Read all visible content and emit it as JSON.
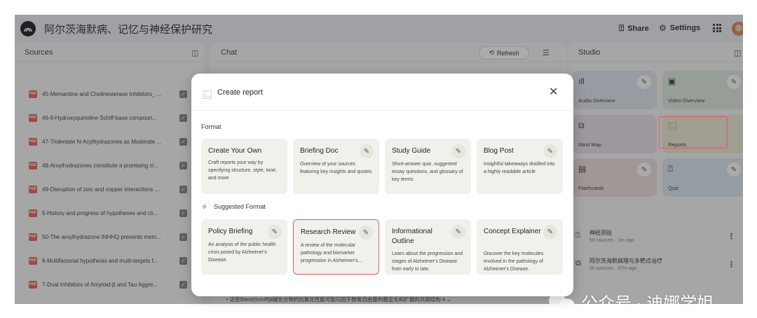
{
  "app": {
    "title": "阿尔茨海默病、记忆与神经保护研究",
    "share_label": "Share",
    "settings_label": "Settings",
    "icons": {
      "logo": "notebook-logo-icon",
      "share": "share-icon",
      "settings": "gear-icon",
      "apps": "apps-grid-icon",
      "avatar": "user-avatar"
    }
  },
  "sources": {
    "title": "Sources",
    "items": [
      {
        "label": "45-Memantine and Cholinesterase Inhibitors_ ...",
        "checked": true
      },
      {
        "label": "46-8-Hydroxyquinoline Schiff-base compoun...",
        "checked": true
      },
      {
        "label": "47-Tridentate N-Acylhydrazones as Moderate ...",
        "checked": true
      },
      {
        "label": "48-Aroylhydrazones constitute a promising cl...",
        "checked": true
      },
      {
        "label": "49-Disruption of zinc and copper interactions ...",
        "checked": true
      },
      {
        "label": "5-History and progress of hypotheses and cli...",
        "checked": true
      },
      {
        "label": "50-The aroylhydrazone INHHQ prevents mem...",
        "checked": true
      },
      {
        "label": "6-Multifactorial hypothesis and multi-targets f...",
        "checked": true
      },
      {
        "label": "7-Dual Inhibitors of Amyloid-β and Tau Aggre...",
        "checked": true
      }
    ]
  },
  "chat": {
    "title": "Chat",
    "refresh_label": "Refresh",
    "bottom_line": "• 这些$\\text{Schiff}$碱化合物的抗氧化性能可能归因于酚氧自由基的稳定化和扩展的共轭结构  4 ⌄"
  },
  "studio": {
    "title": "Studio",
    "cards": [
      {
        "label": "Audio Overview",
        "color": "#dfe3ee"
      },
      {
        "label": "Video Overview",
        "color": "#dde9dc"
      },
      {
        "label": "Mind Map",
        "color": "#e7dce8"
      },
      {
        "label": "Reports",
        "color": "#ede8d2"
      },
      {
        "label": "Flashcards",
        "color": "#ecdcdc"
      },
      {
        "label": "Quiz",
        "color": "#d9e6ef"
      }
    ],
    "notes": [
      {
        "title": "神经测验",
        "meta": "50 sources · 1m ago"
      },
      {
        "title": "阿尔茨海默病理与多靶点治疗",
        "meta": "50 sources · 37m ago"
      }
    ]
  },
  "modal": {
    "title": "Create report",
    "format_label": "Format",
    "suggested_label": "Suggested Format",
    "formats": [
      {
        "title": "Create Your Own",
        "desc": "Craft reports your way by specifying structure, style, tone, and more",
        "editable": false
      },
      {
        "title": "Briefing Doc",
        "desc": "Overview of your sources featuring key insights and quotes",
        "editable": true
      },
      {
        "title": "Study Guide",
        "desc": "Short-answer quiz, suggested essay questions, and glossary of key terms",
        "editable": true
      },
      {
        "title": "Blog Post",
        "desc": "Insightful takeaways distilled into a highly readable article",
        "editable": true
      }
    ],
    "suggested": [
      {
        "title": "Policy Briefing",
        "desc": "An analysis of the public health crisis posed by Alzheimer's Disease.",
        "highlight": false
      },
      {
        "title": "Research Review",
        "desc": "A review of the molecular pathology and biomarker progression in Alzheimer's...",
        "highlight": true
      },
      {
        "title": "Informational Outline",
        "desc": "Learn about the progression and stages of Alzheimer's Disease from early to late.",
        "highlight": false
      },
      {
        "title": "Concept Explainer",
        "desc": "Discover the key molecules involved in the pathology of Alzheimer's Disease.",
        "highlight": false
      }
    ]
  },
  "watermark": {
    "text": "公众号 · 迪娜学姐"
  },
  "colors": {
    "highlight": "#e05b5b",
    "card_bg": "#f1f1ec",
    "pdf_badge": "#e3584a"
  }
}
